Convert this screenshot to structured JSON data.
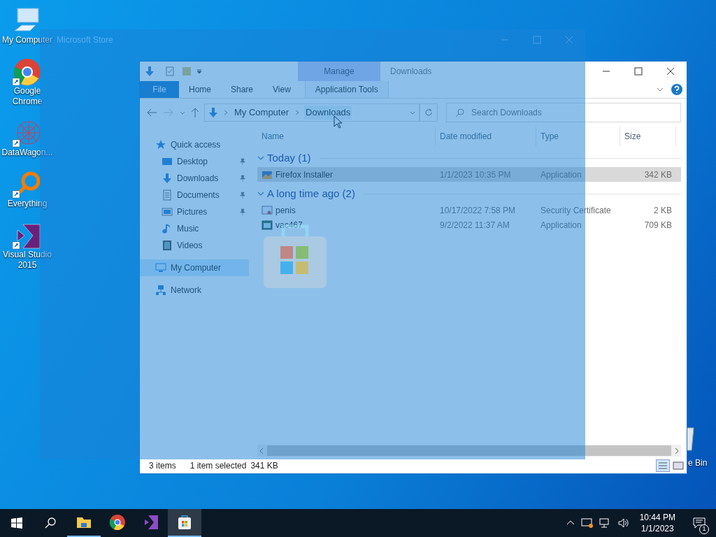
{
  "desktop_icons": [
    {
      "kind": "computer",
      "label": "My Computer"
    },
    {
      "kind": "chrome",
      "label": "Google Chrome"
    },
    {
      "kind": "datawagon",
      "label": "DataWagon..."
    },
    {
      "kind": "everything",
      "label": "Everything"
    },
    {
      "kind": "vs",
      "label": "Visual Studio 2015"
    }
  ],
  "recycle_bin": {
    "label": "e Bin"
  },
  "explorer": {
    "title": "Downloads",
    "context_tab": "Manage",
    "ribbon_tabs": [
      {
        "label": "File",
        "kind": "file",
        "selected": false
      },
      {
        "label": "Home",
        "kind": "tab",
        "selected": false
      },
      {
        "label": "Share",
        "kind": "tab",
        "selected": false
      },
      {
        "label": "View",
        "kind": "tab",
        "selected": false
      },
      {
        "label": "Application Tools",
        "kind": "context",
        "selected": false
      }
    ],
    "address": [
      "My Computer",
      "Downloads"
    ],
    "search": {
      "placeholder": "Search Downloads"
    },
    "nav": [
      {
        "kind": "star",
        "label": "Quick access",
        "selected": false,
        "children": [
          {
            "kind": "desktop",
            "label": "Desktop",
            "pinned": true,
            "selected": false
          },
          {
            "kind": "downloads",
            "label": "Downloads",
            "pinned": true,
            "selected": false
          },
          {
            "kind": "documents",
            "label": "Documents",
            "pinned": true,
            "selected": false
          },
          {
            "kind": "pictures",
            "label": "Pictures",
            "pinned": true,
            "selected": false
          },
          {
            "kind": "music",
            "label": "Music",
            "pinned": false,
            "selected": false
          },
          {
            "kind": "videos",
            "label": "Videos",
            "pinned": false,
            "selected": false
          }
        ]
      },
      {
        "kind": "computer",
        "label": "My Computer",
        "selected": true
      },
      {
        "kind": "network",
        "label": "Network",
        "selected": false
      }
    ],
    "columns": [
      "Name",
      "Date modified",
      "Type",
      "Size"
    ],
    "groups": [
      {
        "title": "Today (1)",
        "expanded": true,
        "files": [
          {
            "kind": "installer",
            "name": "Firefox Installer",
            "date": "1/1/2023 10:35 PM",
            "type": "Application",
            "size": "342 KB",
            "selected": true
          }
        ]
      },
      {
        "title": "A long time ago (2)",
        "expanded": true,
        "files": [
          {
            "kind": "certificate",
            "name": "penis",
            "date": "10/17/2022 7:58 PM",
            "type": "Security Certificate",
            "size": "2 KB",
            "selected": false
          },
          {
            "kind": "app",
            "name": "vac467",
            "date": "9/2/2022 11:37 AM",
            "type": "Application",
            "size": "709 KB",
            "selected": false
          }
        ]
      }
    ],
    "status": [
      "3 items",
      "1 item selected",
      "341 KB"
    ]
  },
  "store": {
    "title": "Microsoft Store"
  },
  "taskbar": {
    "apps": [
      {
        "kind": "explorer",
        "running": true,
        "selected": false
      },
      {
        "kind": "chrome",
        "running": false,
        "selected": false
      },
      {
        "kind": "vs",
        "running": false,
        "selected": false
      },
      {
        "kind": "store",
        "running": true,
        "selected": true
      }
    ],
    "time": "10:44 PM",
    "date": "1/1/2023",
    "notifications": "1"
  }
}
